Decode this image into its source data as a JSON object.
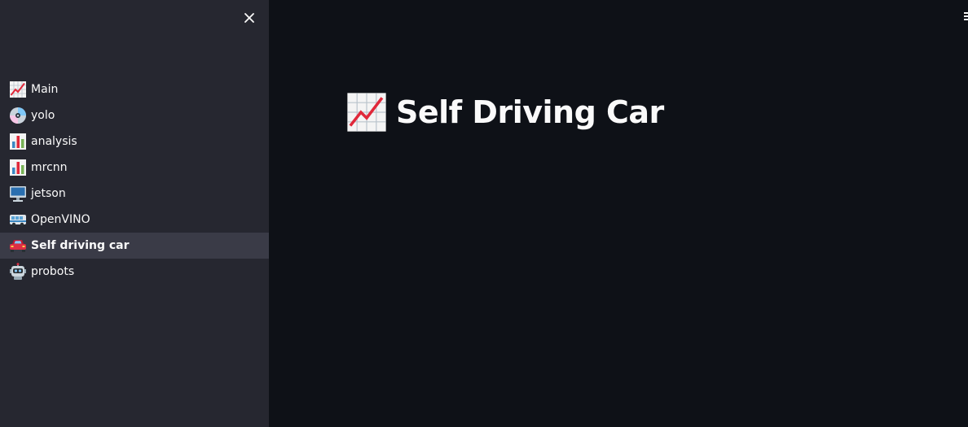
{
  "sidebar": {
    "close_icon": "close-icon",
    "items": [
      {
        "label": "Main",
        "icon": "chart-increasing-icon",
        "active": false
      },
      {
        "label": "yolo",
        "icon": "optical-disc-icon",
        "active": false
      },
      {
        "label": "analysis",
        "icon": "bar-chart-icon",
        "active": false
      },
      {
        "label": "mrcnn",
        "icon": "bar-chart-icon",
        "active": false
      },
      {
        "label": "jetson",
        "icon": "desktop-computer-icon",
        "active": false
      },
      {
        "label": "OpenVINO",
        "icon": "bus-icon",
        "active": false
      },
      {
        "label": "Self driving car",
        "icon": "car-icon",
        "active": true
      },
      {
        "label": "probots",
        "icon": "robot-icon",
        "active": false
      }
    ]
  },
  "main": {
    "title": "Self Driving Car",
    "title_icon": "chart-increasing-icon"
  },
  "colors": {
    "sidebar_bg": "#262730",
    "main_bg": "#0e1117",
    "active_item_bg": "#3a3b47",
    "text": "#fafafa"
  }
}
